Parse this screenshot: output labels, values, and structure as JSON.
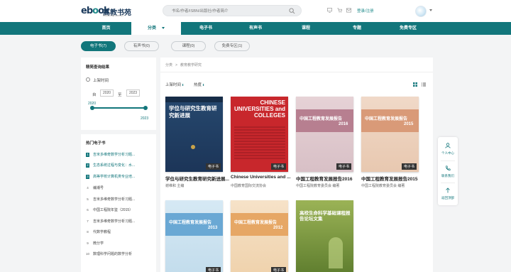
{
  "header": {
    "logo_mark_prefix": "eb",
    "logo_mark_o": "o",
    "logo_mark_suffix": "ok",
    "logo_name": "高教书苑",
    "logo_url": "ebook.hep.com.cn",
    "search_placeholder": "书名/作者/ISBN/出版社/作者简介",
    "login_label": "登录/注册",
    "icons": [
      "search-icon",
      "monitor-icon",
      "cart-icon",
      "message-icon"
    ]
  },
  "nav": {
    "items": [
      {
        "label": "首页",
        "active": false
      },
      {
        "label": "分类",
        "active": true
      },
      {
        "label": "电子书",
        "active": false
      },
      {
        "label": "有声书",
        "active": false
      },
      {
        "label": "课程",
        "active": false
      },
      {
        "label": "专题",
        "active": false
      },
      {
        "label": "免费专区",
        "active": false
      }
    ]
  },
  "tabs": [
    {
      "label": "电子书(7)",
      "active": true
    },
    {
      "label": "有声书(0)",
      "active": false
    },
    {
      "label": "课程(0)",
      "active": false
    },
    {
      "label": "免费专区(1)",
      "active": false
    }
  ],
  "filter": {
    "title": "精简查询结果",
    "radio_label": "上架时间",
    "from_label": "自",
    "from_value": "2020",
    "to_label": "至",
    "to_value": "2023",
    "slider_min_label": "2020",
    "slider_max_label": "2023",
    "slider_min_fraction": 0,
    "slider_max_fraction": 1
  },
  "hot": {
    "title": "热门电子书",
    "items": [
      {
        "rank": "1",
        "title": "吉米多维奇数学分析习题..."
      },
      {
        "rank": "2",
        "title": "生态系统过程与变化：水..."
      },
      {
        "rank": "3",
        "title": "高等学校计算机类专业培..."
      },
      {
        "rank": "4",
        "title": "编潮号"
      },
      {
        "rank": "5",
        "title": "吉米多维奇数学分析习题..."
      },
      {
        "rank": "6",
        "title": "中国工程院年鉴（2015）"
      },
      {
        "rank": "7",
        "title": "吉米多维奇数学分析习题..."
      },
      {
        "rank": "8",
        "title": "代数学教程"
      },
      {
        "rank": "9",
        "title": "微分学"
      },
      {
        "rank": "10",
        "title": "数理科学问题的数学分析"
      }
    ]
  },
  "breadcrumb": {
    "root": "分类",
    "sep": ">",
    "current": "教育教学研究"
  },
  "sort": {
    "time_label": "上架时间",
    "hot_label": "热度",
    "arrow": "⬍"
  },
  "badge_label": "电子书",
  "books": [
    {
      "title": "学位与研究生教育研究新进展...",
      "author": "谢维和 主编",
      "cover_text": "学位与研究生教育研究新进展"
    },
    {
      "title": "Chinese Universities and ...",
      "author": "中国教育国际交流协会",
      "cover_text": "CHINESE UNIVERSITIES and COLLEGES"
    },
    {
      "title": "中国工程教育发展报告2016",
      "author": "中国工程院教育委员会 编著",
      "cover_text": "中国工程教育发展报告",
      "cover_year": "2016"
    },
    {
      "title": "中国工程教育发展报告2015",
      "author": "中国工程院教育委员会 编著",
      "cover_text": "中国工程教育发展报告",
      "cover_year": "2015"
    },
    {
      "title": "",
      "author": "",
      "cover_text": "中国工程教育发展报告",
      "cover_year": "2013"
    },
    {
      "title": "",
      "author": "",
      "cover_text": "中国工程教育发展报告",
      "cover_year": "2012"
    },
    {
      "title": "",
      "author": "",
      "cover_text": "高校生命科学基础课程报告论坛文集"
    }
  ],
  "float": {
    "items": [
      {
        "label": "个人中心",
        "icon": "user-icon"
      },
      {
        "label": "联系我们",
        "icon": "phone-icon"
      },
      {
        "label": "返回顶部",
        "icon": "arrow-up-icon"
      }
    ]
  },
  "colors": {
    "accent": "#12767b",
    "background": "#f3f4f5"
  }
}
